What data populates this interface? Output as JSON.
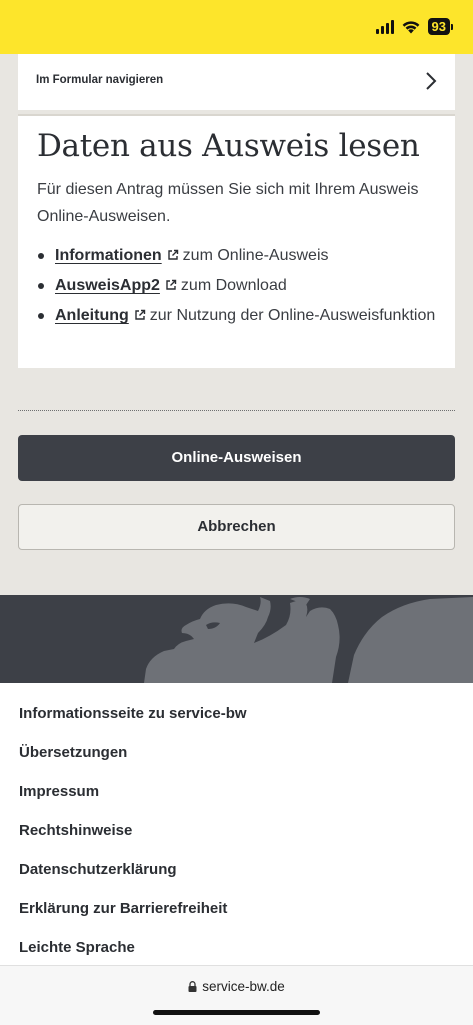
{
  "status_bar": {
    "battery": "93"
  },
  "form_nav": {
    "label": "Im Formular navigieren"
  },
  "section": {
    "heading": "Daten aus Ausweis lesen",
    "intro": "Für diesen Antrag müssen Sie sich mit Ihrem Ausweis Online-Ausweisen.",
    "items": [
      {
        "link": "Informationen",
        "text": "zum Online-Ausweis"
      },
      {
        "link": "AusweisApp2",
        "text": "zum Download"
      },
      {
        "link": "Anleitung",
        "text": "zur Nutzung der Online-Ausweisfunktion"
      }
    ]
  },
  "actions": {
    "primary_label": "Online-Ausweisen",
    "secondary_label": "Abbrechen"
  },
  "footer": {
    "links": [
      "Informationsseite zu service-bw",
      "Übersetzungen",
      "Impressum",
      "Rechtshinweise",
      "Datenschutzerklärung",
      "Erklärung zur Barrierefreiheit",
      "Leichte Sprache"
    ]
  },
  "browser": {
    "url": "service-bw.de"
  },
  "colors": {
    "status_bar": "#fde52b",
    "primary_button": "#3d4047",
    "footer_banner": "#3d4047"
  }
}
